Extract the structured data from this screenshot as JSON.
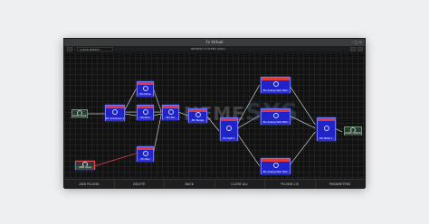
{
  "window": {
    "title": "Fx Virtual"
  },
  "toolbar": {
    "selector": "CLEAR PRESET",
    "status": "NEMESIS SYSTEMS (PRO)"
  },
  "watermark": {
    "line1": "NEME",
    "line2": "SYS"
  },
  "nodes": {
    "input_left": "Audio Input",
    "midi_input": "MIDI Input",
    "crossover": "Eln Crossover 1",
    "top_dist": "Eln Drive",
    "mid_fx": "Eln Mod",
    "bottom_fx": "Eln Rev",
    "mixer_small": "Eln Mix",
    "split_out": "Eln Merge",
    "split_main": "Eln Split 1",
    "right_top": "Eln Analog Verb Stmr",
    "right_mid": "Eln Analog Verb Stmr",
    "right_bot": "Eln Analog Verb Stmr",
    "mixer_right": "Eln Mixer 1",
    "output_right": "Audio Output"
  },
  "footer": {
    "buttons": [
      "ADD PLUGIN",
      "DELETE",
      "BACK",
      "CLOSE ALL",
      "PLUGIN C/S",
      "PARAMETERS"
    ]
  },
  "colors": {
    "node_fill": "#1f23c8",
    "node_header": "#e03a3a",
    "wire": "#c9cbd0",
    "midi_wire": "#d23a3a",
    "canvas": "#121212"
  }
}
